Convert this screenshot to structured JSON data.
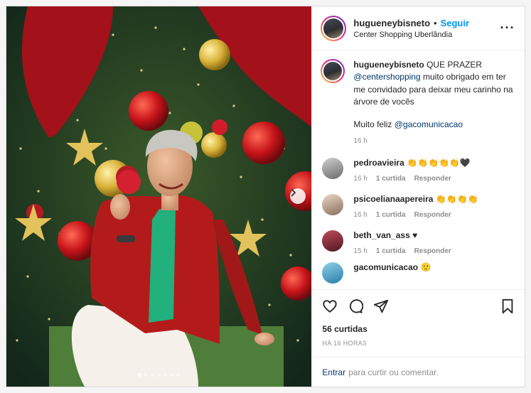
{
  "post": {
    "author": "hugueneybisneto",
    "separator": "•",
    "follow_label": "Seguir",
    "location": "Center Shopping Uberlândia",
    "more_icon": "more-horizontal-icon",
    "carousel": {
      "total_slides": 7,
      "active_index": 0
    }
  },
  "caption": {
    "author": "hugueneybisneto",
    "text_a": " QUE PRAZER ",
    "mention_a": "@centershopping",
    "text_b": " muito obrigado em ter me convidado para deixar meu carinho na árvore de vocês",
    "text_c": "Muito feliz ",
    "mention_b": "@gacomunicacao",
    "time": "16 h"
  },
  "comments": [
    {
      "user": "pedroavieira",
      "text": "👏👏👏👏👏🖤",
      "time": "16 h",
      "likes": "1 curtida",
      "reply": "Responder"
    },
    {
      "user": "psicoelianaapereira",
      "text": "👏👏👏👏",
      "time": "16 h",
      "likes": "1 curtida",
      "reply": "Responder"
    },
    {
      "user": "beth_van_ass",
      "text": "♥",
      "time": "15 h",
      "likes": "1 curtida",
      "reply": "Responder"
    },
    {
      "user": "gacomunicacao",
      "text": "🙂"
    }
  ],
  "footer": {
    "likes": "56 curtidas",
    "timestamp": "HÁ 16 HORAS",
    "add_link": "Entrar",
    "add_placeholder": "para curtir ou comentar."
  },
  "colors": {
    "accent": "#0095f6",
    "mention": "#00376b",
    "muted": "#8e8e8e"
  }
}
